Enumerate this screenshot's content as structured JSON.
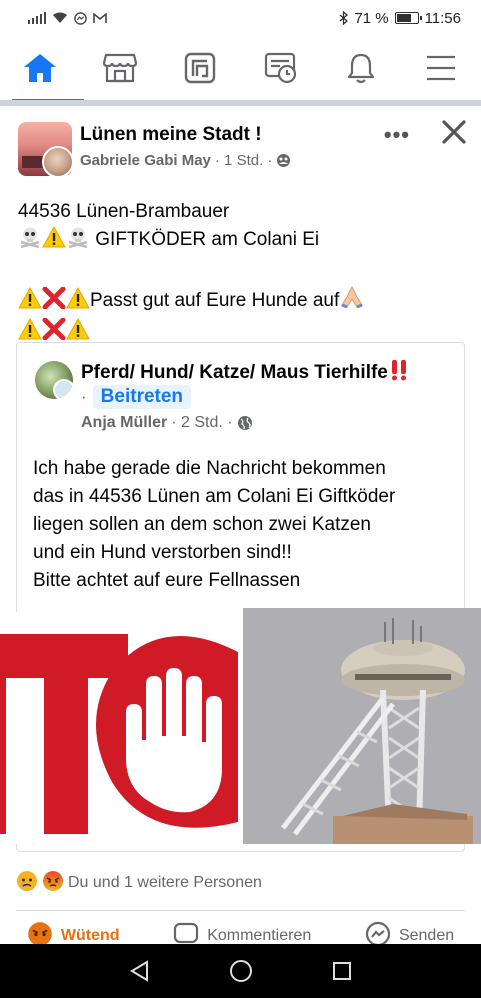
{
  "status_bar": {
    "battery": "71 %",
    "battery_level": 0.71,
    "time": "11:56",
    "icons": [
      "signal-icon",
      "wifi-icon",
      "messenger-icon",
      "gmail-icon",
      "bluetooth-icon",
      "battery-icon"
    ]
  },
  "nav": {
    "items": [
      {
        "name": "home",
        "icon": "home-icon",
        "active": true
      },
      {
        "name": "marketplace",
        "icon": "marketplace-icon",
        "active": false
      },
      {
        "name": "groups",
        "icon": "groups-icon",
        "active": false
      },
      {
        "name": "watch",
        "icon": "memories-icon",
        "active": false
      },
      {
        "name": "notifications",
        "icon": "bell-icon",
        "active": false
      },
      {
        "name": "menu",
        "icon": "hamburger-icon",
        "active": false
      }
    ],
    "accent": "#1877f2"
  },
  "post": {
    "group_name": "Lünen meine Stadt !",
    "author": "Gabriele Gabi May",
    "time": "· 1 Std. ·",
    "more": "•••",
    "body": {
      "line1": "44536 Lünen-Brambauer",
      "line2_text": "GIFTKÖDER am Colani Ei",
      "line3_text": "Passt gut auf Eure Hunde auf"
    }
  },
  "shared": {
    "group_name": "Pferd/ Hund/ Katze/ Maus Tierhilfe",
    "bullet": "·",
    "join": "Beitreten",
    "author": "Anja Müller",
    "time": "· 2 Std. ·",
    "text": [
      "Ich habe gerade die Nachricht bekommen",
      "das in 44536 Lünen am Colani Ei Giftköder",
      "liegen sollen an dem schon zwei Katzen",
      "und ein Hund verstorben sind!!",
      "Bitte achtet auf eure Fellnassen"
    ]
  },
  "reactions": {
    "summary": "Du und 1 weitere Personen"
  },
  "actions": {
    "react": "Wütend",
    "comment": "Kommentieren",
    "send": "Senden"
  }
}
